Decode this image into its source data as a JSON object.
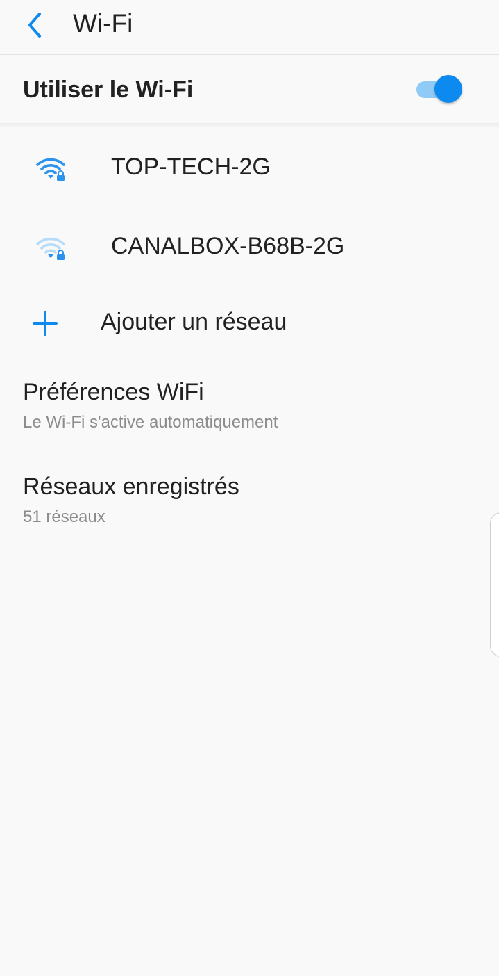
{
  "header": {
    "title": "Wi-Fi",
    "back_icon": "chevron-left-icon"
  },
  "master_switch": {
    "label": "Utiliser le Wi-Fi",
    "state": "on",
    "accent_color": "#0d8af0"
  },
  "networks": [
    {
      "ssid": "TOP-TECH-2G",
      "icon": "wifi-lock-icon",
      "signal_bars": 3,
      "secured": true
    },
    {
      "ssid": "CANALBOX-B68B-2G",
      "icon": "wifi-lock-icon",
      "signal_bars": 1,
      "secured": true
    }
  ],
  "add_network": {
    "label": "Ajouter un réseau",
    "icon": "plus-icon"
  },
  "preferences": [
    {
      "title": "Préférences WiFi",
      "subtitle": "Le Wi-Fi s'active automatiquement"
    },
    {
      "title": "Réseaux enregistrés",
      "subtitle": "51 réseaux"
    }
  ]
}
